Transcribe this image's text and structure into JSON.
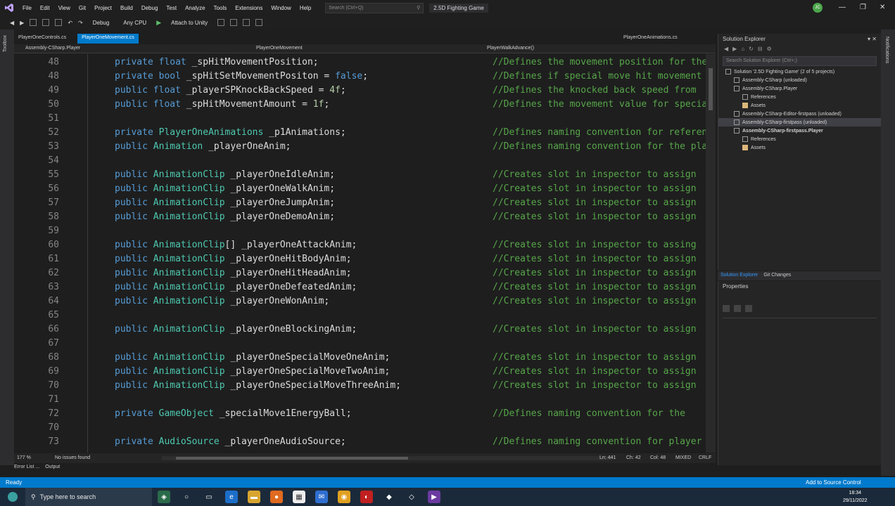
{
  "menu": [
    "File",
    "Edit",
    "View",
    "Git",
    "Project",
    "Build",
    "Debug",
    "Test",
    "Analyze",
    "Tools",
    "Extensions",
    "Window",
    "Help"
  ],
  "search_placeholder": "Search (Ctrl+Q)",
  "solution_title": "2.5D Fighting Game",
  "avatar_initials": "JC",
  "toolbar": {
    "config": "Debug",
    "platform": "Any CPU",
    "attach": "Attach to Unity"
  },
  "left_strip_label": "Toolbox",
  "tabs": [
    {
      "label": "PlayerOneControls.cs",
      "active": false
    },
    {
      "label": "PlayerOneMovement.cs",
      "active": true
    }
  ],
  "tab_right": "PlayerOneAnimations.cs",
  "navbar": {
    "project": "Assembly-CSharp.Player",
    "class": "PlayerOneMovement",
    "member": "PlayerWalkAdvance()"
  },
  "code_lines": [
    {
      "n": "48",
      "code": [
        [
          "kw",
          "private"
        ],
        [
          "id",
          " "
        ],
        [
          "kw",
          "float"
        ],
        [
          "id",
          " _spHitMovementPosition;"
        ]
      ],
      "cmt": "//Defines the movement position for the"
    },
    {
      "n": "48",
      "code": [
        [
          "kw",
          "private"
        ],
        [
          "id",
          " "
        ],
        [
          "kw",
          "bool"
        ],
        [
          "id",
          " _spHitSetMovementPositon = "
        ],
        [
          "kw",
          "false"
        ],
        [
          "id",
          ";"
        ]
      ],
      "cmt": "//Defines if special move hit movement"
    },
    {
      "n": "49",
      "code": [
        [
          "kw",
          "public"
        ],
        [
          "id",
          " "
        ],
        [
          "kw",
          "float"
        ],
        [
          "id",
          " _playerSPKnockBackSpeed = "
        ],
        [
          "nm",
          "4f"
        ],
        [
          "id",
          ";"
        ]
      ],
      "cmt": "//Defines the knocked back speed from"
    },
    {
      "n": "50",
      "code": [
        [
          "kw",
          "public"
        ],
        [
          "id",
          " "
        ],
        [
          "kw",
          "float"
        ],
        [
          "id",
          " _spHitMovementAmount = "
        ],
        [
          "nm",
          "1f"
        ],
        [
          "id",
          ";"
        ]
      ],
      "cmt": "//Defines the movement value for special"
    },
    {
      "n": "51",
      "code": [],
      "cmt": ""
    },
    {
      "n": "52",
      "code": [
        [
          "kw",
          "private"
        ],
        [
          "id",
          " "
        ],
        [
          "ty",
          "PlayerOneAnimations"
        ],
        [
          "id",
          " _p1Animations;"
        ]
      ],
      "cmt": "//Defines naming convention for reference"
    },
    {
      "n": "53",
      "code": [
        [
          "kw",
          "public"
        ],
        [
          "id",
          " "
        ],
        [
          "ty",
          "Animation"
        ],
        [
          "id",
          " _playerOneAnim;"
        ]
      ],
      "cmt": "//Defines naming convention for the player"
    },
    {
      "n": "54",
      "code": [],
      "cmt": ""
    },
    {
      "n": "55",
      "code": [
        [
          "kw",
          "public"
        ],
        [
          "id",
          " "
        ],
        [
          "ty",
          "AnimationClip"
        ],
        [
          "id",
          " _playerOneIdleAnim;"
        ]
      ],
      "cmt": "//Creates slot in inspector to assign"
    },
    {
      "n": "56",
      "code": [
        [
          "kw",
          "public"
        ],
        [
          "id",
          " "
        ],
        [
          "ty",
          "AnimationClip"
        ],
        [
          "id",
          " _playerOneWalkAnim;"
        ]
      ],
      "cmt": "//Creates slot in inspector to assign"
    },
    {
      "n": "57",
      "code": [
        [
          "kw",
          "public"
        ],
        [
          "id",
          " "
        ],
        [
          "ty",
          "AnimationClip"
        ],
        [
          "id",
          " _playerOneJumpAnim;"
        ]
      ],
      "cmt": "//Creates slot in inspector to assign"
    },
    {
      "n": "58",
      "code": [
        [
          "kw",
          "public"
        ],
        [
          "id",
          " "
        ],
        [
          "ty",
          "AnimationClip"
        ],
        [
          "id",
          " _playerOneDemoAnim;"
        ]
      ],
      "cmt": "//Creates slot in inspector to assign"
    },
    {
      "n": "59",
      "code": [],
      "cmt": ""
    },
    {
      "n": "60",
      "code": [
        [
          "kw",
          "public"
        ],
        [
          "id",
          " "
        ],
        [
          "ty",
          "AnimationClip"
        ],
        [
          "id",
          "[] _playerOneAttackAnim;"
        ]
      ],
      "cmt": "//Creates slot in inspector to assing"
    },
    {
      "n": "61",
      "code": [
        [
          "kw",
          "public"
        ],
        [
          "id",
          " "
        ],
        [
          "ty",
          "AnimationClip"
        ],
        [
          "id",
          " _playerOneHitBodyAnim;"
        ]
      ],
      "cmt": "//Creates slot in inspector to assign"
    },
    {
      "n": "62",
      "code": [
        [
          "kw",
          "public"
        ],
        [
          "id",
          " "
        ],
        [
          "ty",
          "AnimationClip"
        ],
        [
          "id",
          " _playerOneHitHeadAnim;"
        ]
      ],
      "cmt": "//Creates slot in inspector to assign"
    },
    {
      "n": "63",
      "code": [
        [
          "kw",
          "public"
        ],
        [
          "id",
          " "
        ],
        [
          "ty",
          "AnimationClip"
        ],
        [
          "id",
          " _playerOneDefeatedAnim;"
        ]
      ],
      "cmt": "//Creates slot in inspector to assign"
    },
    {
      "n": "64",
      "code": [
        [
          "kw",
          "public"
        ],
        [
          "id",
          " "
        ],
        [
          "ty",
          "AnimationClip"
        ],
        [
          "id",
          " _playerOneWonAnim;"
        ]
      ],
      "cmt": "//Creates slot in inspector to assign"
    },
    {
      "n": "65",
      "code": [],
      "cmt": ""
    },
    {
      "n": "66",
      "code": [
        [
          "kw",
          "public"
        ],
        [
          "id",
          " "
        ],
        [
          "ty",
          "AnimationClip"
        ],
        [
          "id",
          " _playerOneBlockingAnim;"
        ]
      ],
      "cmt": "//Creates slot in inspector to assign"
    },
    {
      "n": "67",
      "code": [],
      "cmt": ""
    },
    {
      "n": "68",
      "code": [
        [
          "kw",
          "public"
        ],
        [
          "id",
          " "
        ],
        [
          "ty",
          "AnimationClip"
        ],
        [
          "id",
          " _playerOneSpecialMoveOneAnim;"
        ]
      ],
      "cmt": "//Creates slot in inspector to assign"
    },
    {
      "n": "69",
      "code": [
        [
          "kw",
          "public"
        ],
        [
          "id",
          " "
        ],
        [
          "ty",
          "AnimationClip"
        ],
        [
          "id",
          " _playerOneSpecialMoveTwoAnim;"
        ]
      ],
      "cmt": "//Creates slot in inspector to assign"
    },
    {
      "n": "70",
      "code": [
        [
          "kw",
          "public"
        ],
        [
          "id",
          " "
        ],
        [
          "ty",
          "AnimationClip"
        ],
        [
          "id",
          " _playerOneSpecialMoveThreeAnim;"
        ]
      ],
      "cmt": "//Creates slot in inspector to assign"
    },
    {
      "n": "71",
      "code": [],
      "cmt": ""
    },
    {
      "n": "72",
      "code": [
        [
          "kw",
          "private"
        ],
        [
          "id",
          " "
        ],
        [
          "ty",
          "GameObject"
        ],
        [
          "id",
          " _specialMove1EnergyBall;"
        ]
      ],
      "cmt": "//Defines naming convention for the"
    },
    {
      "n": "70",
      "code": [],
      "cmt": ""
    },
    {
      "n": "73",
      "code": [
        [
          "kw",
          "private"
        ],
        [
          "id",
          " "
        ],
        [
          "ty",
          "AudioSource"
        ],
        [
          "id",
          " _playerOneAudioSource;"
        ]
      ],
      "cmt": "//Defines naming convention for player"
    }
  ],
  "editor_status": {
    "zoom": "177 %",
    "issues": "No issues found",
    "ln": "Ln: 441",
    "ch": "Ch: 42",
    "col": "Col: 48",
    "mixed": "MIXED",
    "crlf": "CRLF"
  },
  "bottom_tabs": [
    "Error List ...",
    "Output"
  ],
  "solution_explorer": {
    "title": "Solution Explorer",
    "search_placeholder": "Search Solution Explorer (Ctrl+;)",
    "items": [
      {
        "label": "Solution '2.5D Fighting Game' (2 of 5 projects)",
        "depth": 0,
        "bold": false,
        "folder": false,
        "selected": false
      },
      {
        "label": "Assembly-CSharp (unloaded)",
        "depth": 1,
        "bold": false,
        "folder": false,
        "selected": false
      },
      {
        "label": "Assembly-CSharp.Player",
        "depth": 1,
        "bold": false,
        "folder": false,
        "selected": false
      },
      {
        "label": "References",
        "depth": 2,
        "bold": false,
        "folder": false,
        "selected": false
      },
      {
        "label": "Assets",
        "depth": 2,
        "bold": false,
        "folder": true,
        "selected": false
      },
      {
        "label": "Assembly-CSharp-Editor-firstpass (unloaded)",
        "depth": 1,
        "bold": false,
        "folder": false,
        "selected": false
      },
      {
        "label": "Assembly-CSharp-firstpass (unloaded)",
        "depth": 1,
        "bold": false,
        "folder": false,
        "selected": true
      },
      {
        "label": "Assembly-CSharp-firstpass.Player",
        "depth": 1,
        "bold": true,
        "folder": false,
        "selected": false
      },
      {
        "label": "References",
        "depth": 2,
        "bold": false,
        "folder": false,
        "selected": false
      },
      {
        "label": "Assets",
        "depth": 2,
        "bold": false,
        "folder": true,
        "selected": false
      }
    ],
    "bottom_tabs": [
      "Solution Explorer",
      "Git Changes"
    ]
  },
  "properties_title": "Properties",
  "right_strip_label": "Notifications",
  "status": {
    "ready": "Ready",
    "source_control": "Add to Source Control"
  },
  "taskbar": {
    "search": "Type here to search",
    "time": "18:34",
    "date": "29/11/2022"
  }
}
